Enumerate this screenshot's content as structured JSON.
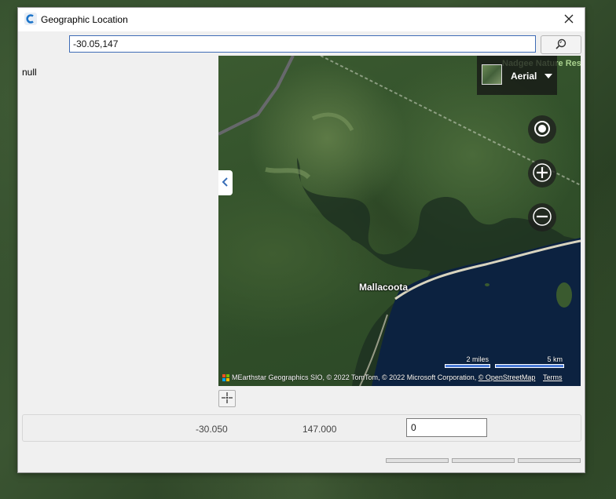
{
  "window": {
    "title": "Geographic Location",
    "app_icon": "app-c-icon",
    "close_icon": "close-icon"
  },
  "search": {
    "value": "-30.05,147",
    "button_icon": "search-icon"
  },
  "side_panel": {
    "text": "null"
  },
  "map": {
    "style_selector": {
      "label": "Aerial",
      "icon": "aerial-thumbnail-icon"
    },
    "overlay_label": "Nadgee Nature Res",
    "place_label": "Mallacoota",
    "controls": {
      "locate_icon": "locate-icon",
      "zoom_in_icon": "plus-icon",
      "zoom_out_icon": "minus-icon",
      "collapse_icon": "chevron-left-icon"
    },
    "scale": {
      "miles": "2 miles",
      "km": "5 km"
    },
    "attribution": {
      "logo": "microsoft-logo-icon",
      "text": "MEarthstar Geographics SIO, © 2022 TomTom, © 2022 Microsoft Corporation, ",
      "link": "© OpenStreetMap",
      "terms": "Terms"
    },
    "colors": {
      "accent": "#4a7bd8",
      "water": "#0c2240",
      "forest": "#34522c"
    }
  },
  "tools": {
    "crosshair_icon": "crosshair-icon"
  },
  "coordinates": {
    "latitude": "-30.050",
    "longitude": "147.000",
    "altitude": "0"
  }
}
